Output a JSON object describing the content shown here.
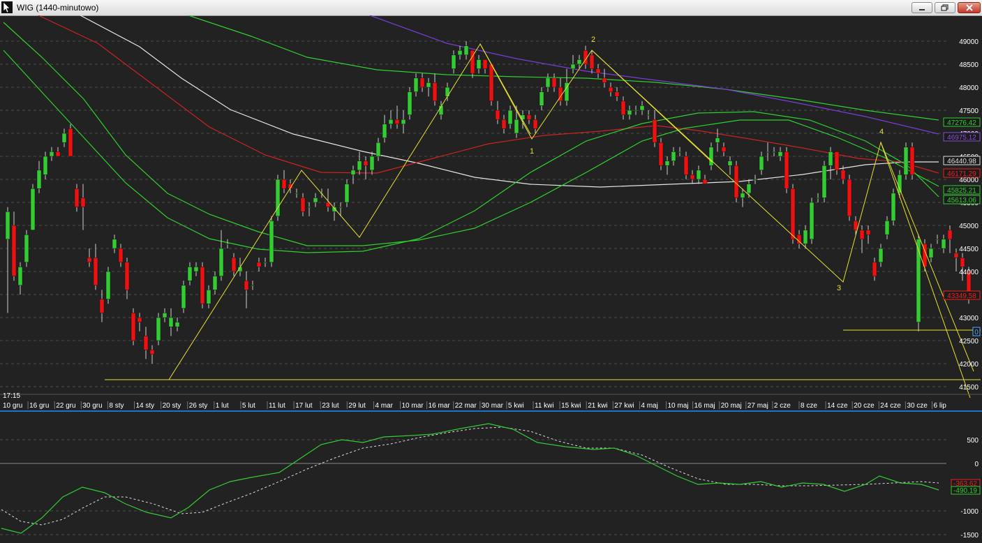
{
  "window": {
    "title": "WIG (1440-minutowo)"
  },
  "colors": {
    "background": "#222222",
    "bull": "#33cc33",
    "bear": "#ee1111",
    "wave": "#e8e030",
    "ma_white": "#e6e6e6",
    "ma_red": "#cc2222",
    "ma_green": "#2ed12e",
    "ma_purple": "#7a3dd6",
    "osc_fast": "#33cc33",
    "osc_slow": "#dddddd"
  },
  "price_axis": {
    "ticks": [
      "49000",
      "48500",
      "48000",
      "47500",
      "47000",
      "46500",
      "46000",
      "45500",
      "45000",
      "44500",
      "44000",
      "43500",
      "43000",
      "42500",
      "42000",
      "41500"
    ]
  },
  "value_badges": [
    {
      "label": "47276.42",
      "color": "#33cc33"
    },
    {
      "label": "46975.12",
      "color": "#8a4dd6"
    },
    {
      "label": "46440.98",
      "color": "#dddddd"
    },
    {
      "label": "46171.29",
      "color": "#ee2222"
    },
    {
      "label": "45825.21",
      "color": "#33cc33"
    },
    {
      "label": "45613.06",
      "color": "#33cc33"
    },
    {
      "label": "43349.58",
      "color": "#ee2222"
    },
    {
      "label": "0",
      "color": "#55aaff"
    }
  ],
  "time_label": "17:15",
  "date_axis": [
    "10 gru",
    "16 gru",
    "22 gru",
    "30 gru",
    "8 sty",
    "14 sty",
    "20 sty",
    "26 sty",
    "1 lut",
    "5 lut",
    "11 lut",
    "17 lut",
    "23 lut",
    "29 lut",
    "4 mar",
    "10 mar",
    "16 mar",
    "22 mar",
    "30 mar",
    "5 kwi",
    "11 kwi",
    "15 kwi",
    "21 kwi",
    "27 kwi",
    "4 maj",
    "10 maj",
    "16 maj",
    "20 maj",
    "27 maj",
    "2 cze",
    "8 cze",
    "14 cze",
    "20 cze",
    "24 cze",
    "30 cze",
    "6 lip"
  ],
  "wave_labels": [
    "1",
    "2",
    "3",
    "4"
  ],
  "oscillator": {
    "axis_ticks": [
      "500",
      "0",
      "-1000",
      "-1500"
    ],
    "badges": [
      {
        "label": "-363.62",
        "color": "#ee2222"
      },
      {
        "label": "-490.19",
        "color": "#33cc33"
      }
    ]
  },
  "candles": [
    [
      44700,
      45400,
      43100,
      45300
    ],
    [
      45000,
      45300,
      43800,
      43900
    ],
    [
      43700,
      44200,
      43500,
      44100
    ],
    [
      44200,
      44900,
      44100,
      44800
    ],
    [
      44900,
      45900,
      44900,
      45800
    ],
    [
      45800,
      46400,
      45700,
      46200
    ],
    [
      46100,
      46600,
      46000,
      46500
    ],
    [
      46500,
      46700,
      46400,
      46600
    ],
    [
      46600,
      46700,
      46500,
      46500
    ],
    [
      46800,
      47100,
      46700,
      47000
    ],
    [
      47100,
      47200,
      46500,
      46500
    ],
    [
      45800,
      45900,
      45300,
      45400
    ],
    [
      45600,
      45900,
      44900,
      45400
    ],
    [
      44300,
      44500,
      44100,
      44200
    ],
    [
      44300,
      44600,
      43600,
      43700
    ],
    [
      43400,
      43600,
      42900,
      43100
    ],
    [
      43400,
      44100,
      43300,
      44000
    ],
    [
      44500,
      44800,
      44400,
      44700
    ],
    [
      44500,
      44600,
      44100,
      44200
    ],
    [
      44200,
      44300,
      43400,
      43600
    ],
    [
      43100,
      43200,
      42400,
      42500
    ],
    [
      43000,
      43100,
      42700,
      42900
    ],
    [
      42600,
      42800,
      42100,
      42300
    ],
    [
      42300,
      42400,
      42000,
      42200
    ],
    [
      42500,
      43100,
      42400,
      43000
    ],
    [
      43000,
      43200,
      42900,
      43100
    ],
    [
      42800,
      43200,
      42600,
      43000
    ],
    [
      42800,
      43000,
      42700,
      42900
    ],
    [
      43200,
      43800,
      43100,
      43700
    ],
    [
      43800,
      44200,
      43700,
      44100
    ],
    [
      44000,
      44200,
      43900,
      44100
    ],
    [
      44100,
      44200,
      43200,
      43300
    ],
    [
      43300,
      43700,
      43200,
      43600
    ],
    [
      43600,
      44000,
      43500,
      43900
    ],
    [
      43900,
      44900,
      43800,
      44500
    ],
    [
      44600,
      44700,
      44500,
      44600
    ],
    [
      44300,
      44400,
      43900,
      44000
    ],
    [
      44000,
      44300,
      43900,
      44100
    ],
    [
      43800,
      44000,
      43200,
      43600
    ],
    [
      43700,
      43800,
      43600,
      43700
    ],
    [
      44200,
      44300,
      44000,
      44100
    ],
    [
      44200,
      44300,
      44100,
      44200
    ],
    [
      44200,
      45200,
      44100,
      45100
    ],
    [
      45200,
      46100,
      45100,
      46000
    ],
    [
      46000,
      46200,
      45700,
      45800
    ],
    [
      45900,
      46000,
      45700,
      45800
    ],
    [
      45700,
      45800,
      45600,
      45700
    ],
    [
      45600,
      45700,
      45200,
      45300
    ],
    [
      45400,
      45500,
      45200,
      45400
    ],
    [
      45500,
      45700,
      45400,
      45600
    ],
    [
      45700,
      45800,
      45600,
      45700
    ],
    [
      45500,
      45800,
      45300,
      45400
    ],
    [
      45300,
      45500,
      45100,
      45400
    ],
    [
      45400,
      45500,
      45200,
      45400
    ],
    [
      45500,
      46000,
      45400,
      45900
    ],
    [
      46100,
      46300,
      45900,
      46200
    ],
    [
      46200,
      46600,
      46100,
      46400
    ],
    [
      46400,
      46500,
      46000,
      46300
    ],
    [
      46200,
      46600,
      46100,
      46500
    ],
    [
      46500,
      46900,
      46400,
      46800
    ],
    [
      46900,
      47400,
      46800,
      47200
    ],
    [
      47200,
      47500,
      47100,
      47300
    ],
    [
      47300,
      47600,
      47100,
      47200
    ],
    [
      47200,
      47500,
      47000,
      47300
    ],
    [
      47400,
      48000,
      47300,
      47900
    ],
    [
      47900,
      48300,
      47800,
      48200
    ],
    [
      48200,
      48300,
      47900,
      48000
    ],
    [
      48000,
      48200,
      47800,
      48100
    ],
    [
      48100,
      48300,
      47600,
      47700
    ],
    [
      47400,
      47700,
      47300,
      47600
    ],
    [
      47800,
      48100,
      47700,
      48000
    ],
    [
      48400,
      48800,
      48300,
      48700
    ],
    [
      48700,
      48900,
      48600,
      48800
    ],
    [
      48700,
      49000,
      48600,
      48900
    ],
    [
      48800,
      48800,
      48200,
      48300
    ],
    [
      48400,
      48700,
      48300,
      48600
    ],
    [
      48600,
      48600,
      48300,
      48400
    ],
    [
      48500,
      48500,
      47600,
      47700
    ],
    [
      47500,
      47700,
      47200,
      47300
    ],
    [
      47300,
      47400,
      47000,
      47100
    ],
    [
      47200,
      47600,
      47100,
      47500
    ],
    [
      47000,
      47600,
      46900,
      47300
    ],
    [
      47300,
      47500,
      47100,
      47400
    ],
    [
      47400,
      47500,
      47200,
      47300
    ],
    [
      47300,
      47400,
      47000,
      47100
    ],
    [
      47600,
      48000,
      47500,
      47900
    ],
    [
      48000,
      48300,
      47900,
      48200
    ],
    [
      48200,
      48300,
      47900,
      48000
    ],
    [
      48000,
      48200,
      47600,
      47700
    ],
    [
      47700,
      48400,
      47600,
      48100
    ],
    [
      48400,
      48700,
      48300,
      48500
    ],
    [
      48500,
      48700,
      48400,
      48600
    ],
    [
      48800,
      48900,
      48400,
      48500
    ],
    [
      48700,
      48800,
      48300,
      48400
    ],
    [
      48400,
      48500,
      48200,
      48300
    ],
    [
      48200,
      48400,
      48000,
      48100
    ],
    [
      48000,
      48100,
      47800,
      47900
    ],
    [
      47900,
      48000,
      47700,
      47800
    ],
    [
      47700,
      47800,
      47300,
      47400
    ],
    [
      47400,
      47600,
      47300,
      47500
    ],
    [
      47500,
      47600,
      47400,
      47500
    ],
    [
      47500,
      47700,
      47400,
      47600
    ],
    [
      47400,
      47500,
      47300,
      47400
    ],
    [
      47300,
      47500,
      46700,
      46800
    ],
    [
      46800,
      46900,
      46200,
      46300
    ],
    [
      46300,
      46500,
      46100,
      46400
    ],
    [
      46400,
      46700,
      46300,
      46600
    ],
    [
      46600,
      46700,
      46500,
      46600
    ],
    [
      46500,
      46600,
      46000,
      46100
    ],
    [
      46100,
      46200,
      45900,
      46000
    ],
    [
      46000,
      46300,
      45900,
      46200
    ],
    [
      46000,
      46100,
      45900,
      45900
    ],
    [
      46300,
      46800,
      46200,
      46700
    ],
    [
      46800,
      47100,
      46600,
      46900
    ],
    [
      46700,
      46800,
      46500,
      46600
    ],
    [
      46300,
      46500,
      46100,
      46400
    ],
    [
      46300,
      46400,
      45500,
      45600
    ],
    [
      45600,
      45800,
      45400,
      45700
    ],
    [
      45700,
      46000,
      45600,
      45900
    ],
    [
      46000,
      46100,
      45900,
      46000
    ],
    [
      46200,
      46600,
      46100,
      46500
    ],
    [
      46600,
      46800,
      46400,
      46600
    ],
    [
      46600,
      46700,
      46500,
      46600
    ],
    [
      46500,
      46700,
      46400,
      46600
    ],
    [
      46600,
      46700,
      45700,
      45800
    ],
    [
      45800,
      45900,
      44600,
      44700
    ],
    [
      44800,
      44900,
      44500,
      44600
    ],
    [
      44600,
      45000,
      44500,
      44900
    ],
    [
      44700,
      45600,
      44600,
      45500
    ],
    [
      45600,
      45700,
      45500,
      45600
    ],
    [
      45600,
      46400,
      45500,
      46300
    ],
    [
      46300,
      46700,
      46000,
      46600
    ],
    [
      46600,
      46600,
      46100,
      46200
    ],
    [
      46200,
      46300,
      45900,
      46000
    ],
    [
      46000,
      46100,
      45100,
      45200
    ],
    [
      45100,
      45200,
      44800,
      44900
    ],
    [
      44900,
      45000,
      44400,
      44700
    ],
    [
      44900,
      45000,
      44600,
      44800
    ],
    [
      44200,
      44300,
      43800,
      43900
    ],
    [
      44200,
      44600,
      44100,
      44500
    ],
    [
      44800,
      45200,
      44700,
      45100
    ],
    [
      45100,
      45800,
      45000,
      45700
    ],
    [
      45700,
      46200,
      45600,
      46100
    ],
    [
      46100,
      46800,
      46000,
      46700
    ],
    [
      46700,
      46800,
      46000,
      46100
    ],
    [
      42900,
      44800,
      42700,
      44700
    ],
    [
      44600,
      44700,
      44000,
      44100
    ],
    [
      44300,
      44600,
      44200,
      44500
    ],
    [
      44700,
      44800,
      44600,
      44700
    ],
    [
      44500,
      44800,
      44400,
      44700
    ],
    [
      44900,
      45000,
      44400,
      44700
    ],
    [
      44400,
      44500,
      44000,
      44300
    ],
    [
      44300,
      44400,
      43800,
      44100
    ],
    [
      44000,
      44100,
      43300,
      43400
    ]
  ]
}
